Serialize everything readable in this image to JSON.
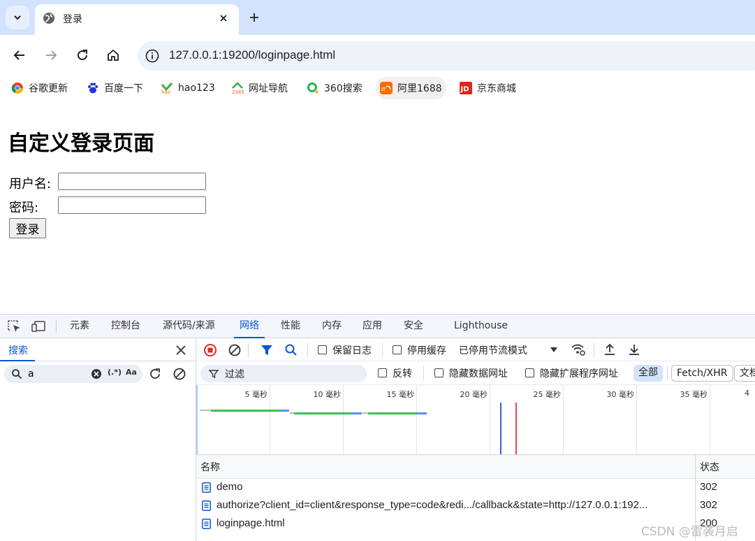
{
  "browser": {
    "tab_title": "登录",
    "url": "127.0.0.1:19200/loginpage.html",
    "bookmarks": [
      {
        "label": "谷歌更新",
        "icon": "chrome-icon"
      },
      {
        "label": "百度一下",
        "icon": "baidu-icon"
      },
      {
        "label": "hao123",
        "icon": "hao123-icon"
      },
      {
        "label": "网址导航",
        "icon": "2345-icon"
      },
      {
        "label": "360搜索",
        "icon": "360-search-icon"
      },
      {
        "label": "阿里1688",
        "icon": "alibaba-1688-icon"
      },
      {
        "label": "京东商城",
        "icon": "jd-icon"
      }
    ]
  },
  "page": {
    "heading": "自定义登录页面",
    "username_label": "用户名:",
    "password_label": "密码:",
    "submit_label": "登录",
    "username_value": "",
    "password_value": ""
  },
  "devtools": {
    "tabs": [
      "元素",
      "控制台",
      "源代码/来源",
      "网络",
      "性能",
      "内存",
      "应用",
      "安全",
      "Lighthouse"
    ],
    "active_tab": "网络",
    "search": {
      "title": "搜索",
      "query": "a",
      "regex_label": "(.*)",
      "case_label": "Aa"
    },
    "network": {
      "preserve_log": "保留日志",
      "disable_cache": "停用缓存",
      "throttling": "已停用节流模式",
      "filter_placeholder": "过滤",
      "invert": "反转",
      "hide_data_urls": "隐藏数据网址",
      "hide_extension_urls": "隐藏扩展程序网址",
      "type_filters": [
        "全部",
        "Fetch/XHR",
        "文档"
      ],
      "timeline_ticks": [
        "5 毫秒",
        "10 毫秒",
        "15 毫秒",
        "20 毫秒",
        "25 毫秒",
        "30 毫秒",
        "35 毫秒",
        "4"
      ],
      "columns": {
        "name": "名称",
        "status": "状态"
      },
      "rows": [
        {
          "name": "demo",
          "status": "302"
        },
        {
          "name": "authorize?client_id=client&response_type=code&redi.../callback&state=http://127.0.0.1:192...",
          "status": "302"
        },
        {
          "name": "loginpage.html",
          "status": "200"
        }
      ]
    }
  },
  "watermark": "CSDN @雷袭月启",
  "colors": {
    "accent": "#0b57d0",
    "tab_strip": "#d3e3fd",
    "record_red": "#d93025"
  }
}
